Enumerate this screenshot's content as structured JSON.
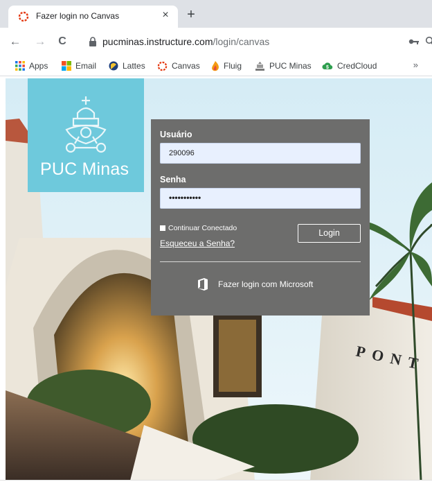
{
  "browser": {
    "tab": {
      "title": "Fazer login no Canvas",
      "close_glyph": "×"
    },
    "new_tab_glyph": "+",
    "nav": {
      "back_glyph": "←",
      "forward_glyph": "→",
      "reload_glyph": "C"
    },
    "url": {
      "host": "pucminas.instructure.com",
      "path": "/login/canvas"
    },
    "bookmarks": [
      {
        "label": "Apps",
        "icon": "apps-grid-icon"
      },
      {
        "label": "Email",
        "icon": "windows-logo-icon"
      },
      {
        "label": "Lattes",
        "icon": "lattes-icon"
      },
      {
        "label": "Canvas",
        "icon": "canvas-logo-icon"
      },
      {
        "label": "Fluig",
        "icon": "fluig-icon"
      },
      {
        "label": "PUC Minas",
        "icon": "pucminas-crest-icon"
      },
      {
        "label": "CredCloud",
        "icon": "credcloud-icon"
      }
    ],
    "bookmarks_overflow": "»"
  },
  "page": {
    "logo": {
      "text": "PUC Minas",
      "bg_color": "#6ec9dc"
    },
    "login": {
      "username_label": "Usuário",
      "username_value": "290096",
      "password_label": "Senha",
      "password_value": "•••••••••••",
      "remember_label": "Continuar Conectado",
      "forgot_link": "Esqueceu a Senha?",
      "login_button": "Login",
      "microsoft_login": "Fazer login com Microsoft",
      "panel_color": "#6d6d6c"
    },
    "building_sign": "PONT"
  }
}
